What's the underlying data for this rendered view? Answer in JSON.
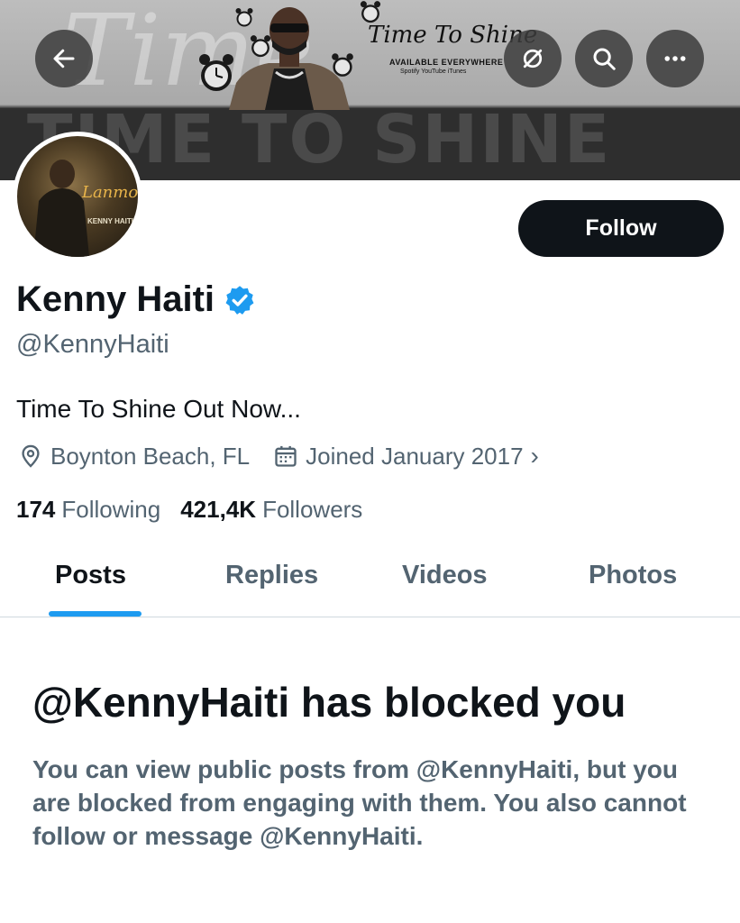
{
  "banner": {
    "big_text": "TIME TO SHINE",
    "title": "Time To Shine",
    "subtitle": "AVAILABLE EVERYWHERE",
    "platforms": "Spotify  YouTube  iTunes"
  },
  "toolbar": {
    "back_icon": "arrow-left-icon",
    "circle_icon": "no-sync-icon",
    "search_icon": "search-icon",
    "more_icon": "more-icon"
  },
  "avatar": {
    "text_main": "Lanmou",
    "text_sub": "KENNY HAITI"
  },
  "profile": {
    "follow_label": "Follow",
    "name": "Kenny Haiti",
    "handle": "@KennyHaiti",
    "bio": "Time To Shine Out Now...",
    "location": "Boynton Beach, FL",
    "joined": "Joined January 2017",
    "following_count": "174",
    "following_label": "Following",
    "followers_count": "421,4K",
    "followers_label": "Followers"
  },
  "tabs": [
    {
      "label": "Posts",
      "active": true
    },
    {
      "label": "Replies",
      "active": false
    },
    {
      "label": "Videos",
      "active": false
    },
    {
      "label": "Photos",
      "active": false
    }
  ],
  "blocked": {
    "title": "@KennyHaiti has blocked you",
    "body": "You can view public posts from @KennyHaiti, but you are blocked from engaging with them. You also cannot follow or message @KennyHaiti."
  },
  "colors": {
    "accent": "#1d9bf0",
    "text_primary": "#0f1419",
    "text_secondary": "#536471",
    "button_dark": "#0f1419"
  }
}
